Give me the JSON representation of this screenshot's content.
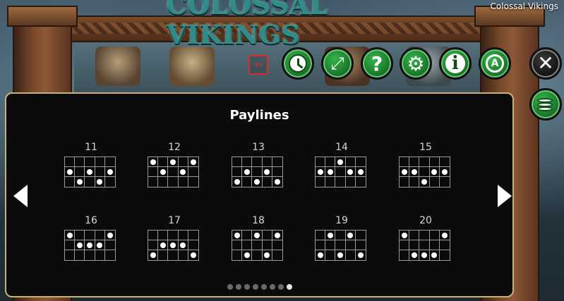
{
  "game": {
    "title": "COLOSSAL VIKINGS",
    "name": "Colossal Vikings"
  },
  "toolbar": {
    "buttons": [
      {
        "name": "history-button",
        "icon": "clock-icon"
      },
      {
        "name": "fullscreen-button",
        "icon": "expand-arrows-icon"
      },
      {
        "name": "help-button",
        "icon": "question-mark-icon"
      },
      {
        "name": "settings-button",
        "icon": "gear-icon"
      },
      {
        "name": "info-button",
        "icon": "info-icon"
      },
      {
        "name": "autoplay-button",
        "icon": "autoplay-icon"
      }
    ],
    "close_icon": "close-icon",
    "coins_icon": "coins-stack-icon",
    "exit_icon": "exit-door-icon"
  },
  "panel": {
    "title": "Paylines",
    "page_count": 8,
    "active_page": 8,
    "paylines": [
      {
        "number": "11",
        "rows": [
          1,
          2,
          1,
          2,
          1
        ]
      },
      {
        "number": "12",
        "rows": [
          0,
          1,
          0,
          1,
          0
        ]
      },
      {
        "number": "13",
        "rows": [
          2,
          1,
          2,
          1,
          2
        ]
      },
      {
        "number": "14",
        "rows": [
          1,
          1,
          0,
          1,
          1
        ]
      },
      {
        "number": "15",
        "rows": [
          1,
          1,
          2,
          1,
          1
        ]
      },
      {
        "number": "16",
        "rows": [
          0,
          1,
          1,
          1,
          0
        ]
      },
      {
        "number": "17",
        "rows": [
          2,
          1,
          1,
          1,
          2
        ]
      },
      {
        "number": "18",
        "rows": [
          0,
          2,
          0,
          2,
          0
        ]
      },
      {
        "number": "19",
        "rows": [
          2,
          0,
          2,
          0,
          2
        ]
      },
      {
        "number": "20",
        "rows": [
          0,
          2,
          2,
          2,
          0
        ]
      }
    ]
  },
  "colors": {
    "panel_border": "#c8b27a",
    "button_green": "#1c7a2c",
    "title_teal": "#2f8c8a"
  }
}
